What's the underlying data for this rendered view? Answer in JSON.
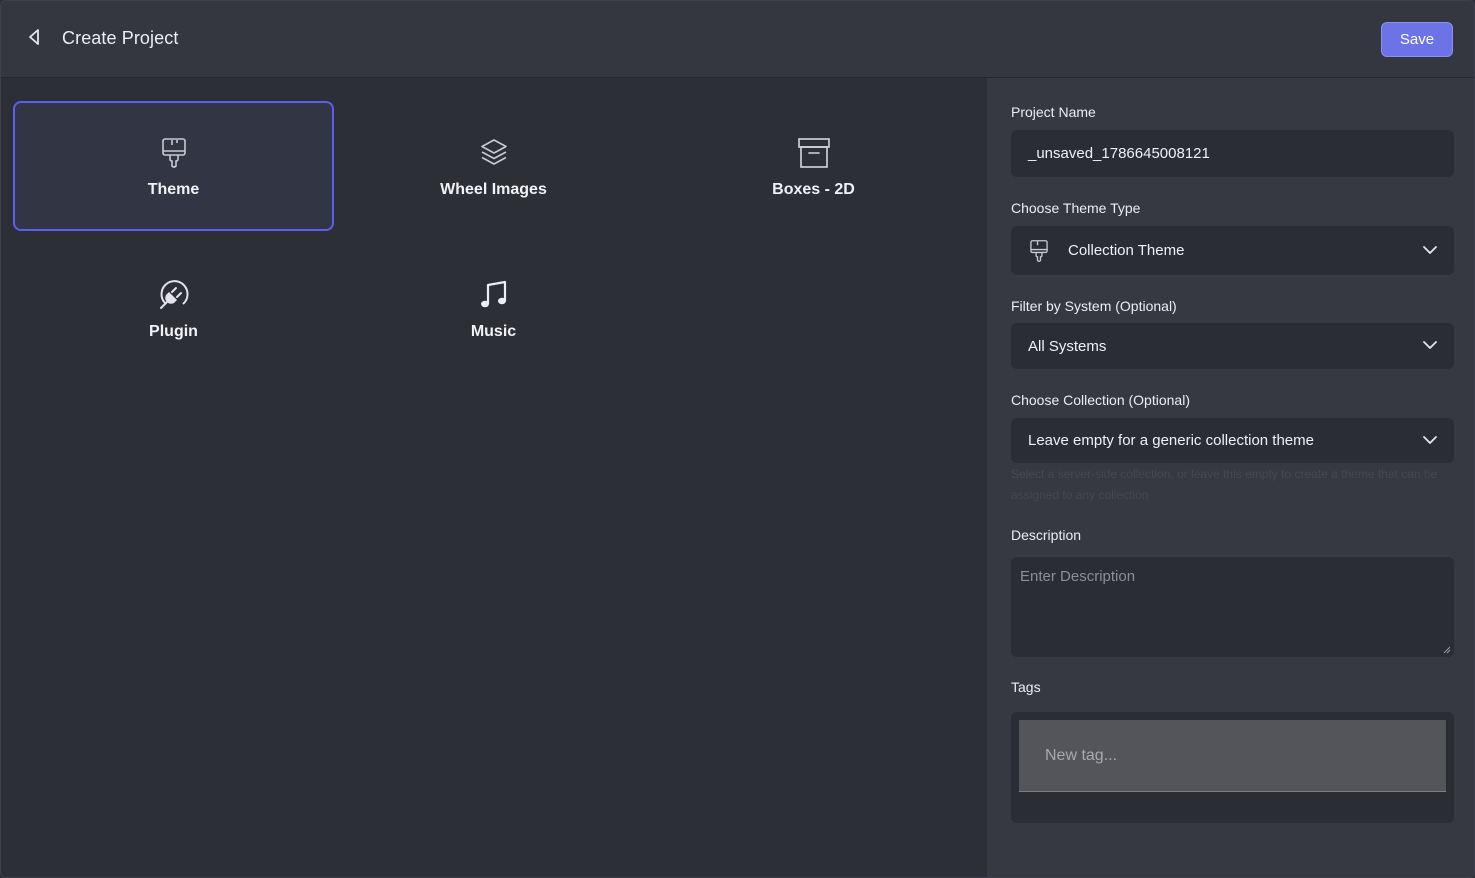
{
  "header": {
    "title": "Create Project",
    "save_label": "Save"
  },
  "project_types": [
    {
      "label": "Theme",
      "icon": "paintbrush-icon",
      "selected": true
    },
    {
      "label": "Wheel Images",
      "icon": "layers-icon",
      "selected": false
    },
    {
      "label": "Boxes - 2D",
      "icon": "archive-box-icon",
      "selected": false
    },
    {
      "label": "Plugin",
      "icon": "plug-icon",
      "selected": false
    },
    {
      "label": "Music",
      "icon": "music-note-icon",
      "selected": false
    }
  ],
  "form": {
    "project_name": {
      "label": "Project Name",
      "value": "_unsaved_1786645008121"
    },
    "theme_type": {
      "label": "Choose Theme Type",
      "value": "Collection Theme",
      "icon": "paintbrush-icon"
    },
    "system_filter": {
      "label": "Filter by System (Optional)",
      "value": "All Systems"
    },
    "collection": {
      "label": "Choose Collection (Optional)",
      "value": "Leave empty for a generic collection theme",
      "hint": "Select a server-side collection, or leave this empty to create a theme that can be assigned to any collection"
    },
    "description": {
      "label": "Description",
      "placeholder": "Enter Description"
    },
    "tags": {
      "label": "Tags",
      "placeholder": "New tag..."
    }
  },
  "colors": {
    "accent": "#6c73e6",
    "selected_border": "#5b5ff0",
    "background": "#2e3037",
    "panel": "#363842"
  }
}
